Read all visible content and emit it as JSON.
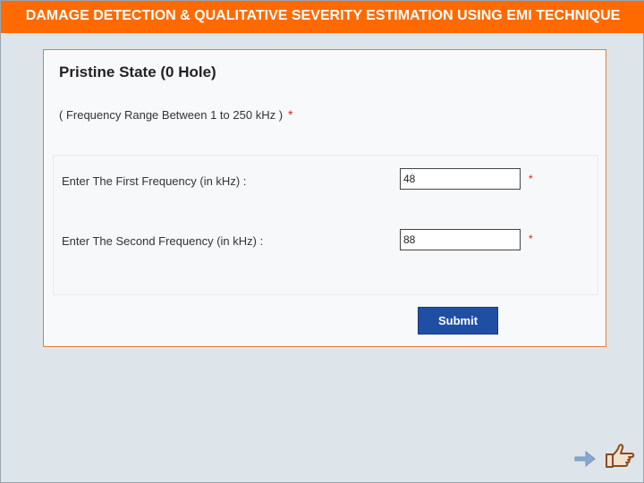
{
  "header": {
    "title": "DAMAGE DETECTION & QUALITATIVE SEVERITY ESTIMATION USING EMI TECHNIQUE"
  },
  "panel": {
    "title": "Pristine State (0 Hole)",
    "range_note": "( Frequency Range Between 1 to 250 kHz )",
    "required_mark": "*"
  },
  "form": {
    "fields": [
      {
        "label": "Enter The First Frequency (in kHz) :",
        "value": "48",
        "required_mark": "*"
      },
      {
        "label": "Enter The Second Frequency (in kHz) :",
        "value": "88",
        "required_mark": "*"
      }
    ],
    "submit_label": "Submit"
  },
  "nav": {
    "icons": [
      "arrow-right-icon",
      "pointing-hand-icon"
    ]
  },
  "colors": {
    "header_bg": "#ff6a00",
    "panel_border": "#e77a3c",
    "submit_bg": "#1f4fa3",
    "required": "#e02020",
    "page_bg": "#dde4ea"
  }
}
